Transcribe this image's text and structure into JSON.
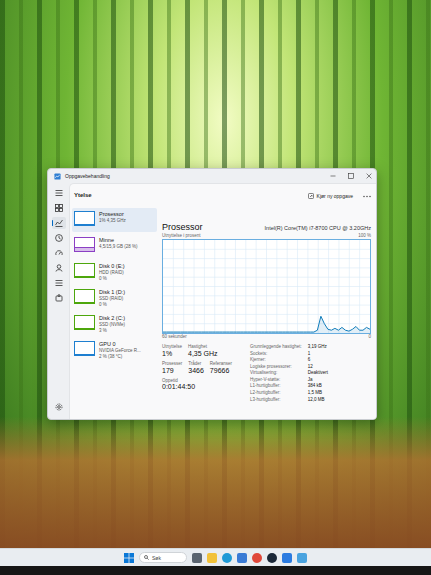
{
  "window": {
    "title": "Oppgavebehandling"
  },
  "header": {
    "title": "Ytelse",
    "run_task": "Kjør ny oppgave"
  },
  "nav": [
    {
      "selected": false
    },
    {
      "selected": true
    },
    {
      "selected": false
    },
    {
      "selected": false
    },
    {
      "selected": false
    },
    {
      "selected": false
    },
    {
      "selected": false
    }
  ],
  "sidebar": [
    {
      "title": "Prosessor",
      "lines": [
        "1% 4,35 GHz"
      ],
      "selected": true,
      "level": 0.01,
      "color": "#1e7fd0"
    },
    {
      "title": "Minne",
      "lines": [
        "4,5/15,9 GB (28 %)"
      ],
      "selected": false,
      "level": 0.28,
      "color": "#8b3fc4"
    },
    {
      "title": "Disk 0 (E:)",
      "lines": [
        "HDD (RAID)",
        "0 %"
      ],
      "selected": false,
      "level": 0,
      "color": "#4da60c"
    },
    {
      "title": "Disk 1 (D:)",
      "lines": [
        "SSD (RAID)",
        "0 %"
      ],
      "selected": false,
      "level": 0,
      "color": "#4da60c"
    },
    {
      "title": "Disk 2 (C:)",
      "lines": [
        "SSD (NVMe)",
        "3 %"
      ],
      "selected": false,
      "level": 0.03,
      "color": "#4da60c"
    },
    {
      "title": "GPU 0",
      "lines": [
        "NVIDIA GeForce R...",
        "2 % (38 °C)"
      ],
      "selected": false,
      "level": 0.02,
      "color": "#1e7fd0"
    }
  ],
  "main": {
    "title": "Prosessor",
    "model": "Intel(R) Core(TM) i7-8700 CPU @ 3.20GHz",
    "chart": {
      "label": "Utnyttelse i prosent",
      "max": "100 %",
      "x_label": "60 sekunder",
      "min": "0",
      "values": [
        1,
        1,
        1,
        1,
        1,
        1,
        1,
        1,
        1,
        1,
        1,
        1,
        1,
        1,
        1,
        1,
        1,
        1,
        1,
        1,
        1,
        1,
        1,
        1,
        1,
        1,
        1,
        1,
        1,
        1,
        1,
        1,
        1,
        1,
        1,
        1,
        1,
        1,
        1,
        1,
        1,
        1,
        1,
        1,
        3,
        18,
        10,
        4,
        3,
        5,
        3,
        6,
        3,
        2,
        4,
        7,
        3,
        3,
        6,
        4
      ]
    },
    "stats": [
      [
        {
          "label": "Utnyttelse",
          "value": "1%"
        },
        {
          "label": "Hastighet",
          "value": "4,35 GHz"
        }
      ],
      [
        {
          "label": "Prosesser",
          "value": "179"
        },
        {
          "label": "Tråder",
          "value": "3466"
        },
        {
          "label": "Referanser",
          "value": "79666"
        }
      ],
      [
        {
          "label": "Oppetid",
          "value": "0:01:44:50"
        }
      ]
    ],
    "details": [
      {
        "key": "Grunnleggende hastighet:",
        "value": "3,19 GHz"
      },
      {
        "key": "Sockets:",
        "value": "1"
      },
      {
        "key": "Kjerner:",
        "value": "6"
      },
      {
        "key": "Logiske prosessorer:",
        "value": "12"
      },
      {
        "key": "Virtualisering:",
        "value": "Deaktivert"
      },
      {
        "key": "Hyper-V-støtte:",
        "value": "Ja"
      },
      {
        "key": "L1-hurtigbuffer:",
        "value": "384 kB"
      },
      {
        "key": "L2-hurtigbuffer:",
        "value": "1,5 MB"
      },
      {
        "key": "L3-hurtigbuffer:",
        "value": "12,0 MB"
      }
    ]
  },
  "taskbar": {
    "search": "Søk"
  }
}
